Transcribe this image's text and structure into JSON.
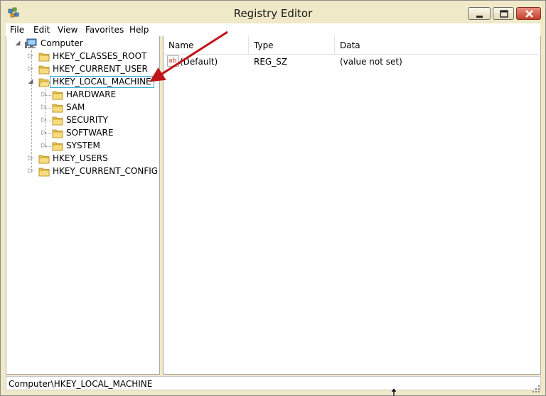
{
  "window": {
    "title": "Registry Editor"
  },
  "menu": [
    "File",
    "Edit",
    "View",
    "Favorites",
    "Help"
  ],
  "tree": {
    "root": "Computer",
    "hives": [
      {
        "label": "HKEY_CLASSES_ROOT"
      },
      {
        "label": "HKEY_CURRENT_USER"
      },
      {
        "label": "HKEY_LOCAL_MACHINE",
        "selected": true,
        "expanded": true,
        "children": [
          "HARDWARE",
          "SAM",
          "SECURITY",
          "SOFTWARE",
          "SYSTEM"
        ]
      },
      {
        "label": "HKEY_USERS"
      },
      {
        "label": "HKEY_CURRENT_CONFIG"
      }
    ]
  },
  "columns": {
    "name": "Name",
    "type": "Type",
    "data": "Data"
  },
  "values": [
    {
      "icon": "string-value-icon",
      "icon_text": "ab",
      "name": "(Default)",
      "type": "REG_SZ",
      "data": "(value not set)"
    }
  ],
  "status": {
    "path": "Computer\\HKEY_LOCAL_MACHINE"
  },
  "annotation": {
    "color": "#c0141a"
  }
}
